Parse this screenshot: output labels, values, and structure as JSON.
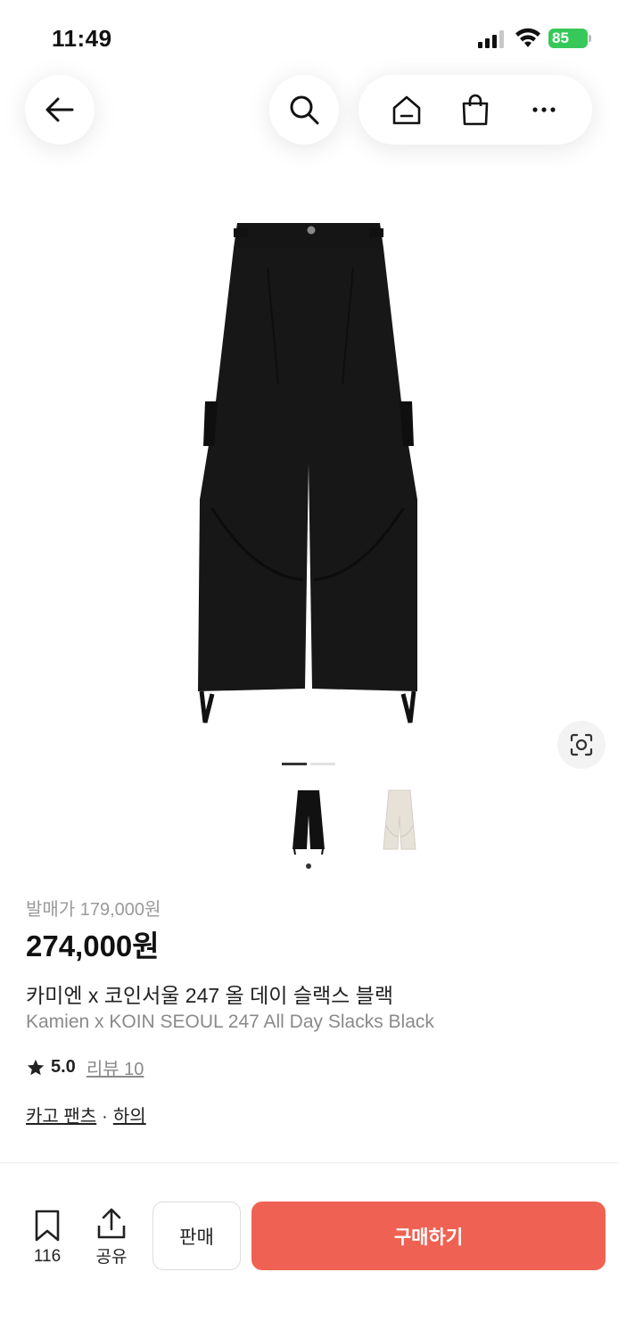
{
  "status_bar": {
    "time": "11:49",
    "battery": "85"
  },
  "nav": {
    "back_icon": "arrow-left-icon",
    "search_icon": "search-icon",
    "home_icon": "home-icon",
    "cart_icon": "shopping-bag-icon",
    "more_icon": "more-horizontal-icon"
  },
  "product": {
    "release_price": "발매가 179,000원",
    "price": "274,000원",
    "title_ko": "카미엔 x 코인서울 247 올 데이 슬랙스 블랙",
    "title_en": "Kamien x KOIN SEOUL 247 All Day Slacks Black",
    "rating": "5.0",
    "review_label": "리뷰 10",
    "category_1": "카고 팬츠",
    "category_sep": "·",
    "category_2": "하의",
    "image_page_current": 1,
    "image_page_total": 2,
    "thumbnail_colors": [
      "#111111",
      "#e6e2d8"
    ]
  },
  "bottom_bar": {
    "bookmark_count": "116",
    "share_label": "공유",
    "sell_label": "판매",
    "buy_label": "구매하기",
    "buy_color": "#ef6253"
  }
}
